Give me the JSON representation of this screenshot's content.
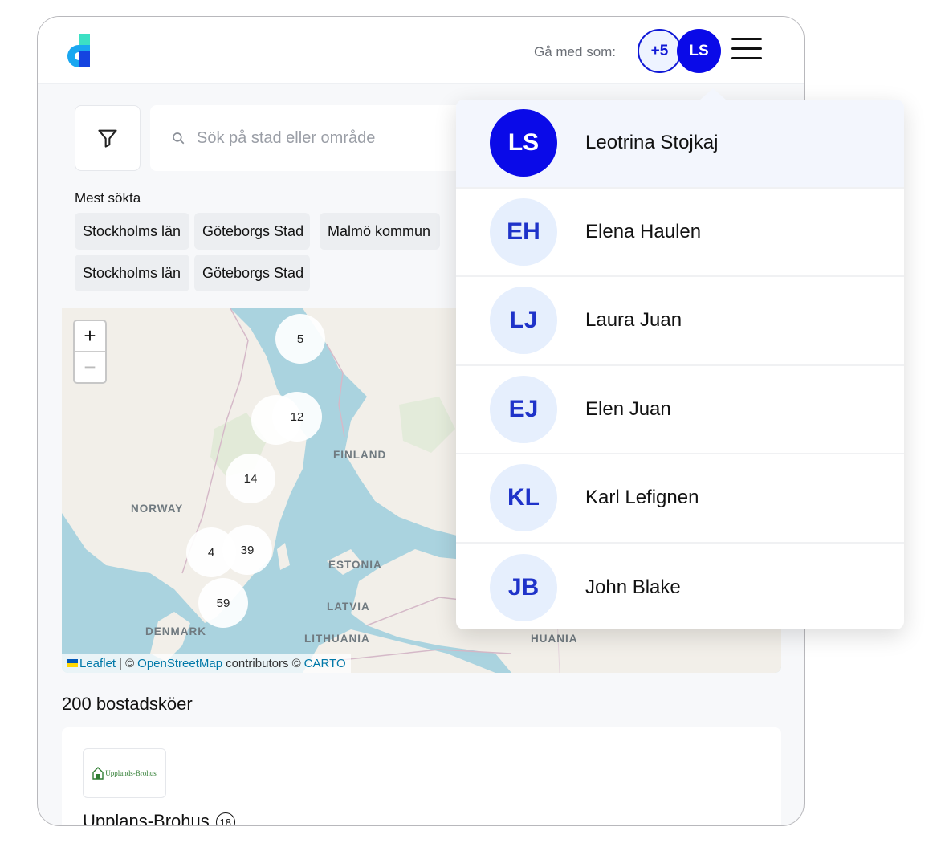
{
  "header": {
    "join_label": "Gå med som:",
    "more_users_badge": "+5",
    "current_user_initials": "LS"
  },
  "search": {
    "placeholder": "Sök på stad eller område"
  },
  "most_searched": {
    "label": "Mest sökta",
    "chips": [
      "Stockholms län",
      "Göteborgs Stad",
      "Malmö kommun",
      "Stockholms län",
      "Göteborgs Stad"
    ]
  },
  "map": {
    "zoom_in": "+",
    "zoom_out": "−",
    "clusters": [
      "5",
      "12",
      "14",
      "4",
      "39",
      "59"
    ],
    "countries": [
      "FINLAND",
      "NORWAY",
      "ESTONIA",
      "LATVIA",
      "DENMARK",
      "LITHUANIA",
      "HUANIA"
    ],
    "attribution": {
      "leaflet": "Leaflet",
      "sep": "| ©",
      "osm": "OpenStreetMap",
      "contributors": "contributors ©",
      "carto": "CARTO"
    }
  },
  "results": {
    "count_label": "200 bostadsköer",
    "first_card": {
      "logo_text": "Upplands-Brohus",
      "title": "Upplans-Brohus",
      "age_badge": "18"
    }
  },
  "user_menu": {
    "users": [
      {
        "initials": "LS",
        "name": "Leotrina Stojkaj",
        "active": true
      },
      {
        "initials": "EH",
        "name": "Elena Haulen"
      },
      {
        "initials": "LJ",
        "name": "Laura Juan"
      },
      {
        "initials": "EJ",
        "name": "Elen Juan"
      },
      {
        "initials": "KL",
        "name": "Karl Lefignen"
      },
      {
        "initials": "JB",
        "name": "John Blake"
      }
    ]
  },
  "colors": {
    "accent": "#0a0ae8",
    "avatar_bg": "#e6effd",
    "map_water": "#aad3df",
    "map_land": "#f2efe9"
  }
}
